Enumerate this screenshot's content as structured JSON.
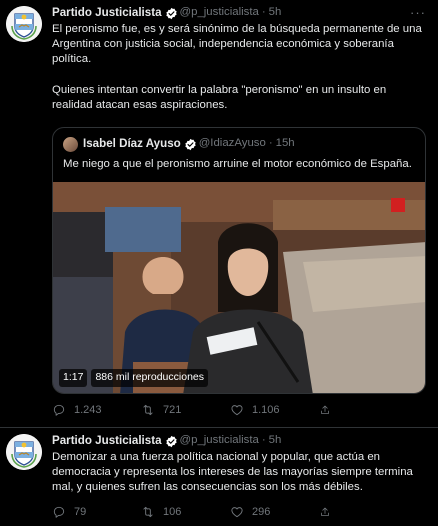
{
  "tweets": [
    {
      "author_name": "Partido Justicialista",
      "handle": "@p_justicialista",
      "separator": "·",
      "time": "5h",
      "more": "···",
      "text": "El peronismo fue, es y será sinónimo de la búsqueda permanente de una Argentina con justicia social, independencia económica y soberanía política.\n\nQuienes intentan convertir la palabra \"peronismo\" en un insulto en realidad atacan esas aspiraciones.",
      "quote": {
        "author_name": "Isabel Díaz Ayuso",
        "handle": "@IdiazAyuso",
        "separator": "·",
        "time": "15h",
        "text": "Me niego a que el peronismo arruine el motor económico de España.",
        "video_duration": "1:17",
        "video_views": "886 mil reproducciones"
      },
      "replies": "1.243",
      "retweets": "721",
      "likes": "1.106"
    },
    {
      "author_name": "Partido Justicialista",
      "handle": "@p_justicialista",
      "separator": "·",
      "time": "5h",
      "text": "Demonizar a una fuerza política nacional y popular, que actúa en democracia y representa los intereses de las mayorías siempre termina mal, y quienes sufren las consecuencias son los más débiles.",
      "replies": "79",
      "retweets": "106",
      "likes": "296"
    }
  ],
  "colors": {
    "background": "#000000",
    "text": "#e7e9ea",
    "secondary": "#71767b",
    "border": "#2f3336",
    "verified": "#ffffff"
  },
  "icons": [
    "avatar-logo",
    "verified-icon",
    "more-icon",
    "reply-icon",
    "retweet-icon",
    "like-icon",
    "share-icon"
  ]
}
